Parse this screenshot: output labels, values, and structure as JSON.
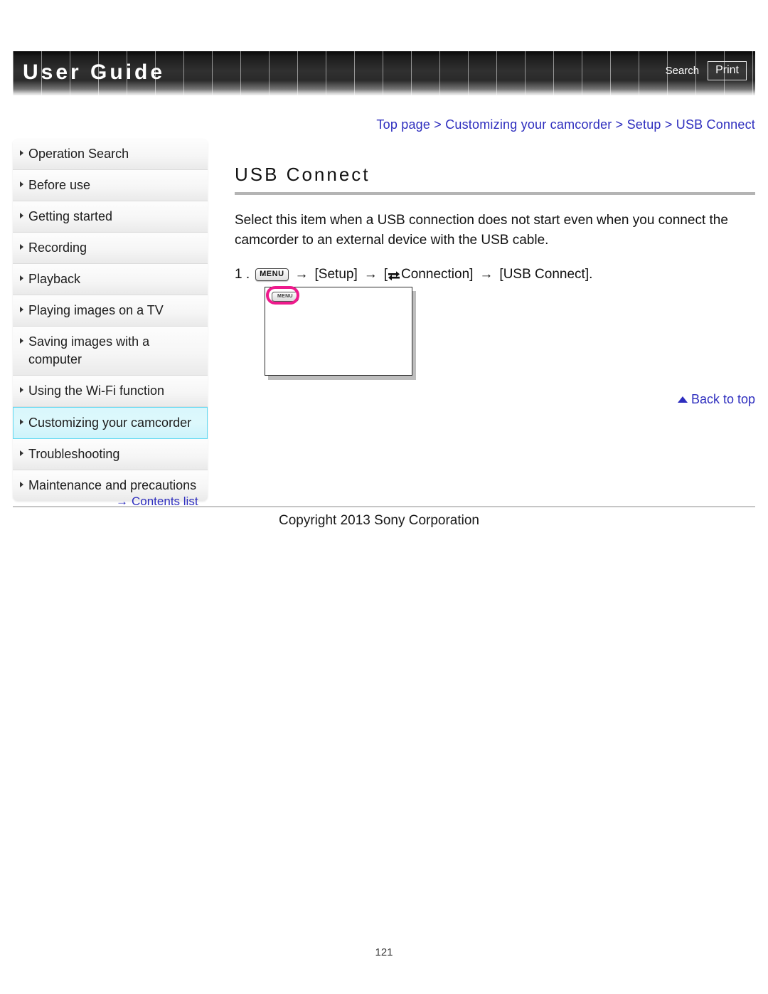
{
  "header": {
    "title": "User Guide",
    "search_label": "Search",
    "print_label": "Print"
  },
  "breadcrumb": {
    "text": "Top page > Customizing your camcorder > Setup > USB Connect"
  },
  "sidebar": {
    "items": [
      {
        "label": "Operation Search",
        "selected": false
      },
      {
        "label": "Before use",
        "selected": false
      },
      {
        "label": "Getting started",
        "selected": false
      },
      {
        "label": "Recording",
        "selected": false
      },
      {
        "label": "Playback",
        "selected": false
      },
      {
        "label": "Playing images on a TV",
        "selected": false
      },
      {
        "label": "Saving images with a computer",
        "selected": false
      },
      {
        "label": "Using the Wi-Fi function",
        "selected": false
      },
      {
        "label": "Customizing your camcorder",
        "selected": true
      },
      {
        "label": "Troubleshooting",
        "selected": false
      },
      {
        "label": "Maintenance and precautions",
        "selected": false
      }
    ],
    "contents_list_label": "Contents list",
    "contents_list_arrow": "→"
  },
  "main": {
    "title": "USB Connect",
    "intro": "Select this item when a USB connection does not start even when you connect the camcorder to an external device with the USB cable.",
    "step": {
      "number": "1 .",
      "menu_icon_label": "MENU",
      "arrow": "→",
      "setup_label": "[Setup]",
      "connection_open": "[",
      "connection_label": "Connection]",
      "usb_connect_label": "[USB Connect]."
    },
    "illustration": {
      "menu_button_label": "MENU",
      "highlight_color": "#ee1a8c"
    },
    "back_to_top_label": "Back to top"
  },
  "footer": {
    "copyright": "Copyright 2013 Sony Corporation",
    "page_number": "121"
  }
}
